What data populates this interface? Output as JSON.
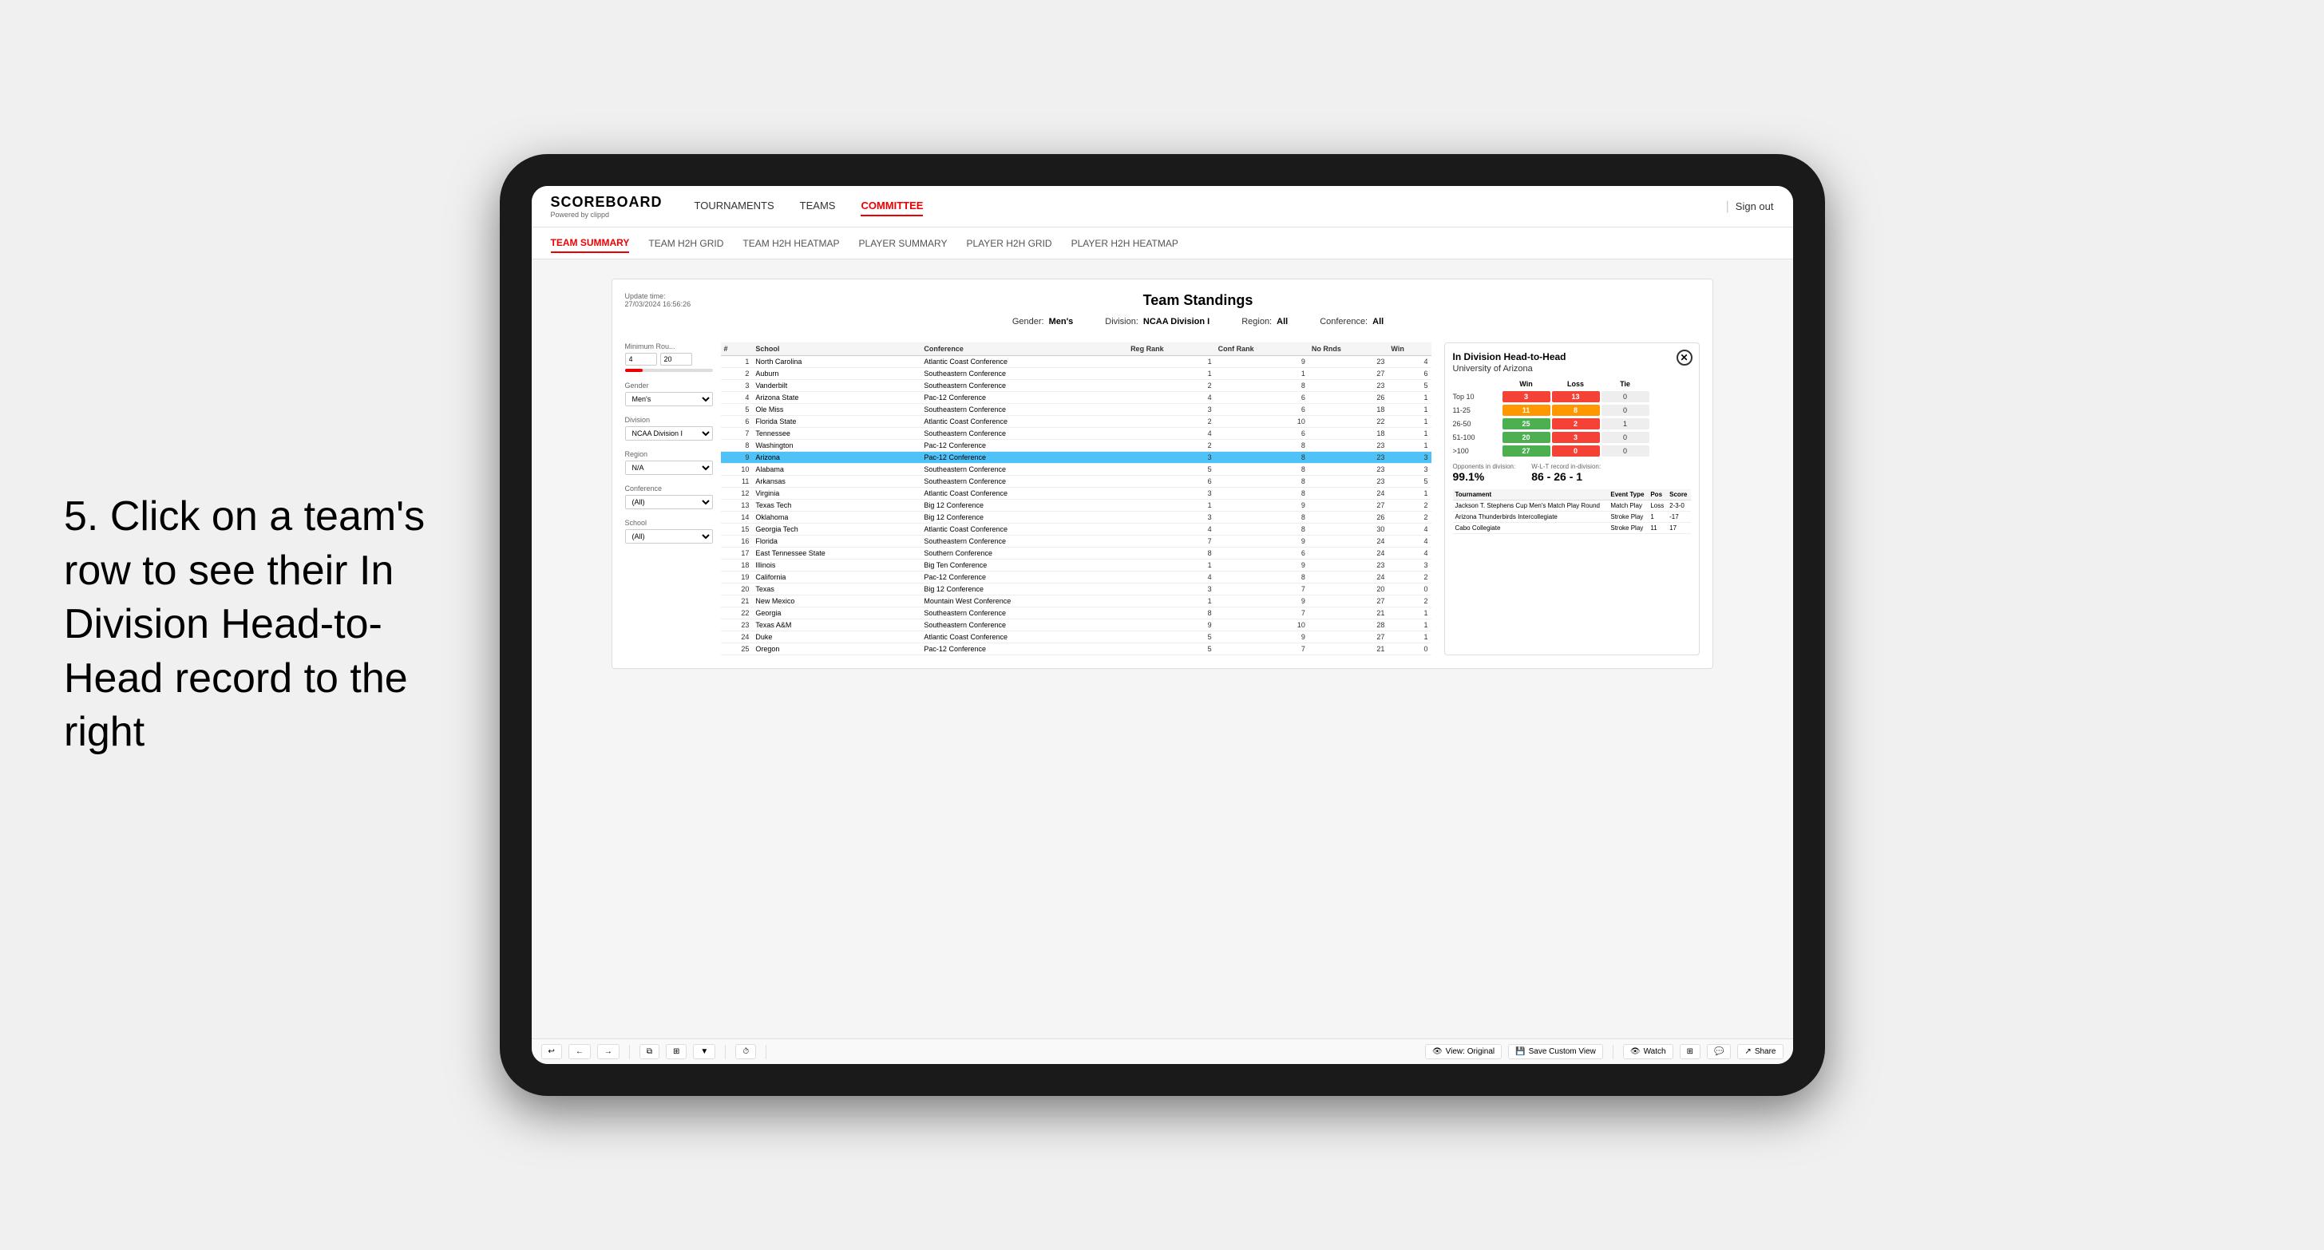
{
  "app": {
    "logo": "SCOREBOARD",
    "logo_sub": "Powered by clippd",
    "sign_out": "Sign out",
    "nav": [
      "TOURNAMENTS",
      "TEAMS",
      "COMMITTEE"
    ],
    "active_nav": "COMMITTEE",
    "sub_nav": [
      "TEAM SUMMARY",
      "TEAM H2H GRID",
      "TEAM H2H HEATMAP",
      "PLAYER SUMMARY",
      "PLAYER H2H GRID",
      "PLAYER H2H HEATMAP"
    ],
    "active_sub_nav": "TEAM SUMMARY"
  },
  "annotation": "5. Click on a team's row to see their In Division Head-to-Head record to the right",
  "main": {
    "update_time_label": "Update time:",
    "update_time": "27/03/2024 16:56:26",
    "title": "Team Standings",
    "gender_label": "Gender:",
    "gender": "Men's",
    "division_label": "Division:",
    "division": "NCAA Division I",
    "region_label": "Region:",
    "region": "All",
    "conference_label": "Conference:",
    "conference": "All"
  },
  "controls": {
    "min_rounds_label": "Minimum Rou...",
    "min_rounds_min": "4",
    "min_rounds_max": "20",
    "gender_label": "Gender",
    "gender_value": "Men's",
    "division_label": "Division",
    "division_value": "NCAA Division I",
    "region_label": "Region",
    "region_value": "N/A",
    "conference_label": "Conference",
    "conference_value": "(All)",
    "school_label": "School",
    "school_value": "(All)"
  },
  "table": {
    "headers": [
      "#",
      "School",
      "Conference",
      "Reg Rank",
      "Conf Rank",
      "No Rnds",
      "Win"
    ],
    "rows": [
      {
        "rank": 1,
        "school": "North Carolina",
        "conference": "Atlantic Coast Conference",
        "reg_rank": 1,
        "conf_rank": 9,
        "no_rnds": 23,
        "win": 4,
        "selected": false
      },
      {
        "rank": 2,
        "school": "Auburn",
        "conference": "Southeastern Conference",
        "reg_rank": 1,
        "conf_rank": 1,
        "no_rnds": 27,
        "win": 6,
        "selected": false
      },
      {
        "rank": 3,
        "school": "Vanderbilt",
        "conference": "Southeastern Conference",
        "reg_rank": 2,
        "conf_rank": 8,
        "no_rnds": 23,
        "win": 5,
        "selected": false
      },
      {
        "rank": 4,
        "school": "Arizona State",
        "conference": "Pac-12 Conference",
        "reg_rank": 4,
        "conf_rank": 6,
        "no_rnds": 26,
        "win": 1,
        "selected": false
      },
      {
        "rank": 5,
        "school": "Ole Miss",
        "conference": "Southeastern Conference",
        "reg_rank": 3,
        "conf_rank": 6,
        "no_rnds": 18,
        "win": 1,
        "selected": false
      },
      {
        "rank": 6,
        "school": "Florida State",
        "conference": "Atlantic Coast Conference",
        "reg_rank": 2,
        "conf_rank": 10,
        "no_rnds": 22,
        "win": 1,
        "selected": false
      },
      {
        "rank": 7,
        "school": "Tennessee",
        "conference": "Southeastern Conference",
        "reg_rank": 4,
        "conf_rank": 6,
        "no_rnds": 18,
        "win": 1,
        "selected": false
      },
      {
        "rank": 8,
        "school": "Washington",
        "conference": "Pac-12 Conference",
        "reg_rank": 2,
        "conf_rank": 8,
        "no_rnds": 23,
        "win": 1,
        "selected": false
      },
      {
        "rank": 9,
        "school": "Arizona",
        "conference": "Pac-12 Conference",
        "reg_rank": 3,
        "conf_rank": 8,
        "no_rnds": 23,
        "win": 3,
        "selected": true
      },
      {
        "rank": 10,
        "school": "Alabama",
        "conference": "Southeastern Conference",
        "reg_rank": 5,
        "conf_rank": 8,
        "no_rnds": 23,
        "win": 3,
        "selected": false
      },
      {
        "rank": 11,
        "school": "Arkansas",
        "conference": "Southeastern Conference",
        "reg_rank": 6,
        "conf_rank": 8,
        "no_rnds": 23,
        "win": 5,
        "selected": false
      },
      {
        "rank": 12,
        "school": "Virginia",
        "conference": "Atlantic Coast Conference",
        "reg_rank": 3,
        "conf_rank": 8,
        "no_rnds": 24,
        "win": 1,
        "selected": false
      },
      {
        "rank": 13,
        "school": "Texas Tech",
        "conference": "Big 12 Conference",
        "reg_rank": 1,
        "conf_rank": 9,
        "no_rnds": 27,
        "win": 2,
        "selected": false
      },
      {
        "rank": 14,
        "school": "Oklahoma",
        "conference": "Big 12 Conference",
        "reg_rank": 3,
        "conf_rank": 8,
        "no_rnds": 26,
        "win": 2,
        "selected": false
      },
      {
        "rank": 15,
        "school": "Georgia Tech",
        "conference": "Atlantic Coast Conference",
        "reg_rank": 4,
        "conf_rank": 8,
        "no_rnds": 30,
        "win": 4,
        "selected": false
      },
      {
        "rank": 16,
        "school": "Florida",
        "conference": "Southeastern Conference",
        "reg_rank": 7,
        "conf_rank": 9,
        "no_rnds": 24,
        "win": 4,
        "selected": false
      },
      {
        "rank": 17,
        "school": "East Tennessee State",
        "conference": "Southern Conference",
        "reg_rank": 8,
        "conf_rank": 6,
        "no_rnds": 24,
        "win": 4,
        "selected": false
      },
      {
        "rank": 18,
        "school": "Illinois",
        "conference": "Big Ten Conference",
        "reg_rank": 1,
        "conf_rank": 9,
        "no_rnds": 23,
        "win": 3,
        "selected": false
      },
      {
        "rank": 19,
        "school": "California",
        "conference": "Pac-12 Conference",
        "reg_rank": 4,
        "conf_rank": 8,
        "no_rnds": 24,
        "win": 2,
        "selected": false
      },
      {
        "rank": 20,
        "school": "Texas",
        "conference": "Big 12 Conference",
        "reg_rank": 3,
        "conf_rank": 7,
        "no_rnds": 20,
        "win": 0,
        "selected": false
      },
      {
        "rank": 21,
        "school": "New Mexico",
        "conference": "Mountain West Conference",
        "reg_rank": 1,
        "conf_rank": 9,
        "no_rnds": 27,
        "win": 2,
        "selected": false
      },
      {
        "rank": 22,
        "school": "Georgia",
        "conference": "Southeastern Conference",
        "reg_rank": 8,
        "conf_rank": 7,
        "no_rnds": 21,
        "win": 1,
        "selected": false
      },
      {
        "rank": 23,
        "school": "Texas A&M",
        "conference": "Southeastern Conference",
        "reg_rank": 9,
        "conf_rank": 10,
        "no_rnds": 28,
        "win": 1,
        "selected": false
      },
      {
        "rank": 24,
        "school": "Duke",
        "conference": "Atlantic Coast Conference",
        "reg_rank": 5,
        "conf_rank": 9,
        "no_rnds": 27,
        "win": 1,
        "selected": false
      },
      {
        "rank": 25,
        "school": "Oregon",
        "conference": "Pac-12 Conference",
        "reg_rank": 5,
        "conf_rank": 7,
        "no_rnds": 21,
        "win": 0,
        "selected": false
      }
    ]
  },
  "h2h": {
    "title": "In Division Head-to-Head",
    "school": "University of Arizona",
    "win_label": "Win",
    "loss_label": "Loss",
    "tie_label": "Tie",
    "ranges": [
      {
        "label": "Top 10",
        "win": 3,
        "loss": 13,
        "tie": 0
      },
      {
        "label": "11-25",
        "win": 11,
        "loss": 8,
        "tie": 0
      },
      {
        "label": "26-50",
        "win": 25,
        "loss": 2,
        "tie": 1
      },
      {
        "label": "51-100",
        "win": 20,
        "loss": 3,
        "tie": 0
      },
      {
        "label": ">100",
        "win": 27,
        "loss": 0,
        "tie": 0
      }
    ],
    "opponents_label": "Opponents in division:",
    "opponents_pct": "99.1%",
    "wlt_label": "W-L-T record in-division:",
    "wlt_value": "86 - 26 - 1",
    "tournaments": [
      {
        "name": "Jackson T. Stephens Cup Men's Match Play Round",
        "type": "Match Play",
        "pos": "Loss",
        "score": "2-3-0"
      },
      {
        "name": "Arizona Thunderbirds Intercollegiate",
        "type": "Stroke Play",
        "pos": 1,
        "score": "-17"
      },
      {
        "name": "Cabo Collegiate",
        "type": "Stroke Play",
        "pos": 11,
        "score": "17"
      }
    ]
  },
  "toolbar": {
    "undo": "↩",
    "redo_prev": "←",
    "redo_next": "→",
    "copy": "⧉",
    "paste": "⊞",
    "clock": "⏱",
    "view_original": "View: Original",
    "save_custom": "Save Custom View",
    "watch": "Watch",
    "share": "Share"
  }
}
